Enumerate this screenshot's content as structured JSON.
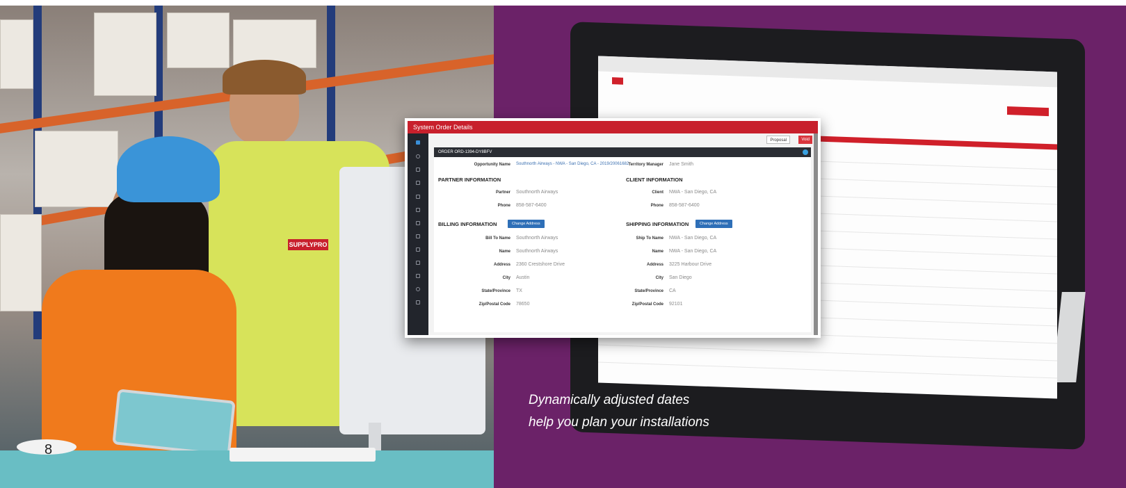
{
  "page_number": "8",
  "caption": {
    "line1": "Dynamically adjusted dates",
    "line2": "help you plan your installations"
  },
  "brand": "SUPPLYPRO",
  "popup": {
    "title": "System Order Details",
    "proposal_button": "Proposal",
    "void_button": "Void",
    "order_id": "ORDER ORD-1394-DY8BFV",
    "opportunity_label": "Opportunity Name",
    "opportunity_value": "Southnorth Airways - NWA - San Diego, CA - 2019/20061682",
    "territory_label": "Territory Manager",
    "territory_value": "Jane Smith",
    "partner_section": "PARTNER INFORMATION",
    "client_section": "CLIENT INFORMATION",
    "partner_label": "Partner",
    "partner_value": "Southnorth Airways",
    "client_label": "Client",
    "client_value": "NWA - San Diego, CA",
    "phone_label": "Phone",
    "partner_phone": "858-587-6400",
    "client_phone": "858-587-6400",
    "billing_section": "BILLING INFORMATION",
    "shipping_section": "SHIPPING INFORMATION",
    "change_address": "Change Address",
    "billing": [
      {
        "label": "Bill To Name",
        "value": "Southnorth Airways"
      },
      {
        "label": "Name",
        "value": "Southnorth Airways"
      },
      {
        "label": "Address",
        "value": "2360 Crestshore Drive"
      },
      {
        "label": "City",
        "value": "Austin"
      },
      {
        "label": "State/Province",
        "value": "TX"
      },
      {
        "label": "Zip/Postal Code",
        "value": "78650"
      }
    ],
    "shipping": [
      {
        "label": "Ship To Name",
        "value": "NWA - San Diego, CA"
      },
      {
        "label": "Name",
        "value": "NWA - San Diego, CA"
      },
      {
        "label": "Address",
        "value": "3225 Harbour Drive"
      },
      {
        "label": "City",
        "value": "San Diego"
      },
      {
        "label": "State/Province",
        "value": "CA"
      },
      {
        "label": "Zip/Postal Code",
        "value": "92101"
      }
    ]
  },
  "colors": {
    "purple": "#6b2268",
    "brand_red": "#c8202c",
    "accent_blue": "#2e6fb7"
  }
}
